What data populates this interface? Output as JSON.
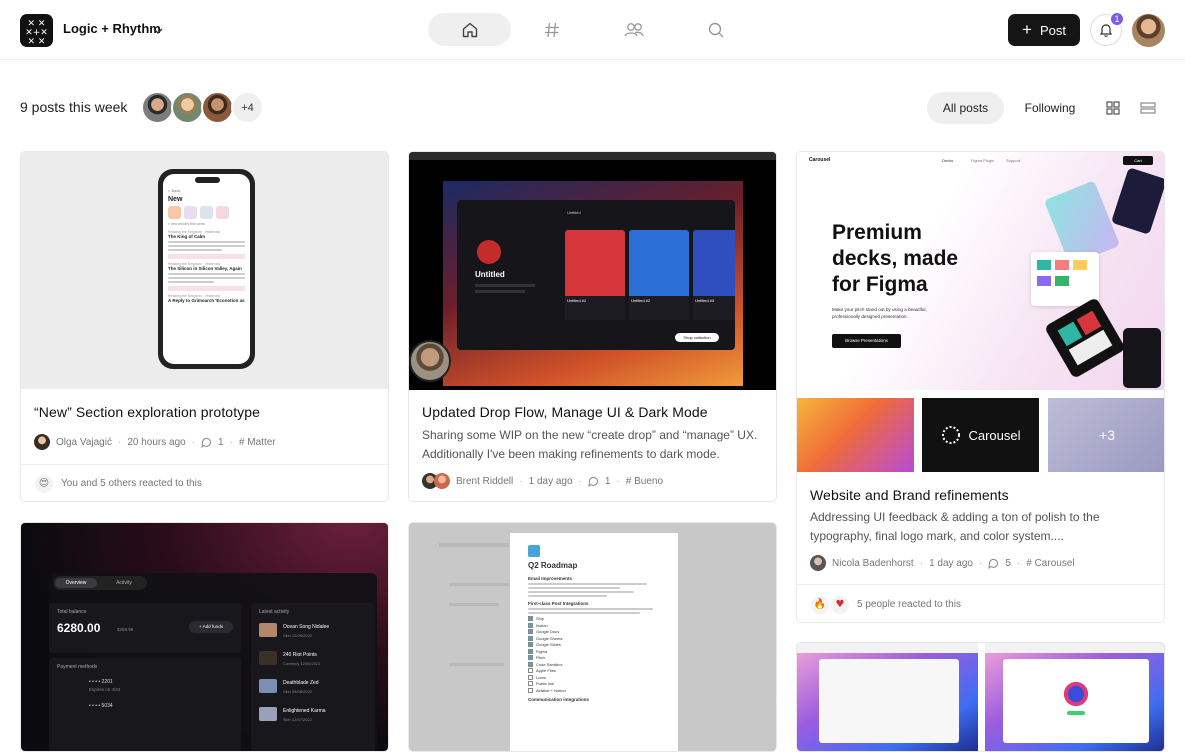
{
  "header": {
    "workspace": "Logic + Rhythm",
    "post_label": "Post",
    "notification_count": "1"
  },
  "colors": {
    "accent": "#7c5ce6",
    "dark": "#151515"
  },
  "nav": {
    "items": [
      "home-icon",
      "hash-icon",
      "people-icon",
      "search-icon"
    ],
    "active": "home-icon"
  },
  "subbar": {
    "summary": "9 posts this week",
    "more_avatars": "+4",
    "filters": [
      "All posts",
      "Following"
    ],
    "active_filter": "All posts"
  },
  "cards": [
    {
      "title": "“New” Section exploration prototype",
      "author": "Olga Vajagić",
      "time": "20 hours ago",
      "comments": "1",
      "channel": "# Matter",
      "reactions": "You and 5 others reacted to this",
      "phone": {
        "back": "< Back",
        "heading": "New",
        "caption": "x new articles this week",
        "source1": "Reading the Kingdom · Yesterday",
        "title1": "The King of Calm",
        "source2": "Reading the Kingdom · Yesterday",
        "title2": "The Silicon in Silicon Valley, Again",
        "source3": "Reading the Kingdom · Yesterday",
        "title3": "A Reply to Grimoarch 'Econotion as"
      }
    },
    {
      "title": "Updated Drop Flow, Manage UI & Dark Mode",
      "description": "Sharing some WIP on the new “create drop” and “manage” UX. Additionally I've been making refinements to dark mode.",
      "author": "Brent Riddell",
      "time": "1 day ago",
      "comments": "1",
      "channel": "# Bueno",
      "shot": {
        "name": "Untitled",
        "tab": "Untitled",
        "card1": "Untitled #1",
        "card2": "Untitled #2",
        "card3": "Untitled #3",
        "shop": "Shop collection",
        "price1": "0.01",
        "price2": "0.01",
        "price3": "0.01"
      }
    },
    {
      "title": "Website and Brand refinements",
      "description": "Addressing UI feedback & adding a ton of polish to the typography, final logo mark, and color system....",
      "author": "Nicola Badenhorst",
      "time": "1 day ago",
      "comments": "5",
      "channel": "# Carousel",
      "reactions": "5 people reacted to this",
      "hero": {
        "brand": "Carousel",
        "nav1": "Decks",
        "nav2": "Figma Plugin",
        "nav3": "Support",
        "cart": "Cart",
        "headline1": "Premium",
        "headline2": "decks, made",
        "headline3": "for Figma",
        "sub1": "Make your pitch stand out by using a beautiful,",
        "sub2": "professionally designed presentation.",
        "cta": "Browse Presentations"
      },
      "tile_brand": "Carousel",
      "more": "+3"
    },
    {
      "dash": {
        "tab1": "Overview",
        "tab2": "Activity",
        "balance_label": "Total balance",
        "balance": "6280.00",
        "balance_sub": "$258.99",
        "add_funds": "+ Add funds",
        "payment_methods": "Payment methods",
        "card1_num": "• • • •  2201",
        "card1_exp": "Expires on 4/24",
        "card2_num": "• • • •  5034",
        "latest": "Latest activity",
        "items": [
          {
            "name": "Ocean Song Nidalee",
            "tag": "Skin",
            "date": "12/09/2022"
          },
          {
            "name": "240 Riot Points",
            "tag": "Currency",
            "date": "12/09/2022"
          },
          {
            "name": "Deathblade Zed",
            "tag": "Skin",
            "date": "08/08/2022"
          },
          {
            "name": "Enlightened Karma",
            "tag": "Skin",
            "date": "12/07/2022"
          }
        ]
      }
    },
    {
      "doc": {
        "title": "Q2 Roadmap",
        "s1": "Email Improvements",
        "s2": "First-class Post Integrations",
        "items": [
          "Ship",
          "Notion",
          "Google Docs",
          "Google Sheets",
          "Google Slides",
          "Figma",
          "Pitch",
          "Code Sandbox",
          "Apple Files",
          "Loom",
          "Public link",
          "Airtable + Notion"
        ],
        "s3": "Communication integrations"
      }
    },
    {}
  ]
}
